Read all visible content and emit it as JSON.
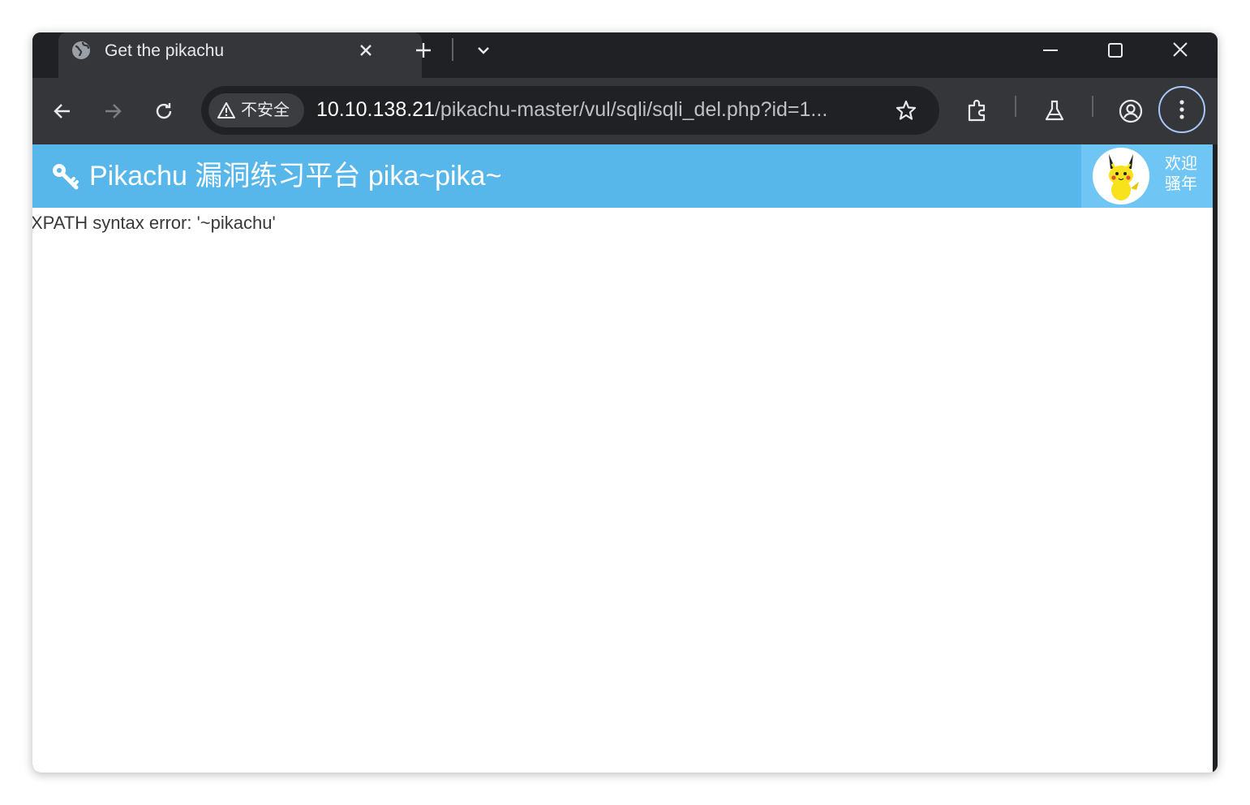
{
  "browser": {
    "tab": {
      "title": "Get the pikachu",
      "favicon": "globe-icon"
    },
    "address_bar": {
      "security_label": "不安全",
      "url_host": "10.10.138.21",
      "url_path": "/pikachu-master/vul/sqli/sqli_del.php?id=1..."
    },
    "icons": [
      "back-arrow-icon",
      "forward-arrow-icon",
      "reload-icon",
      "star-icon",
      "extensions-icon",
      "labs-flask-icon",
      "profile-icon",
      "more-menu-icon"
    ]
  },
  "page": {
    "navbar": {
      "brand": "Pikachu 漏洞练习平台 pika~pika~",
      "welcome_line1": "欢迎",
      "welcome_line2": "骚年"
    },
    "error_message": "XPATH syntax error: '~pikachu'"
  },
  "colors": {
    "navbar": "#57b6ea",
    "user_area": "#6fc6f4",
    "chrome_dark": "#202124",
    "toolbar": "#35363a"
  }
}
